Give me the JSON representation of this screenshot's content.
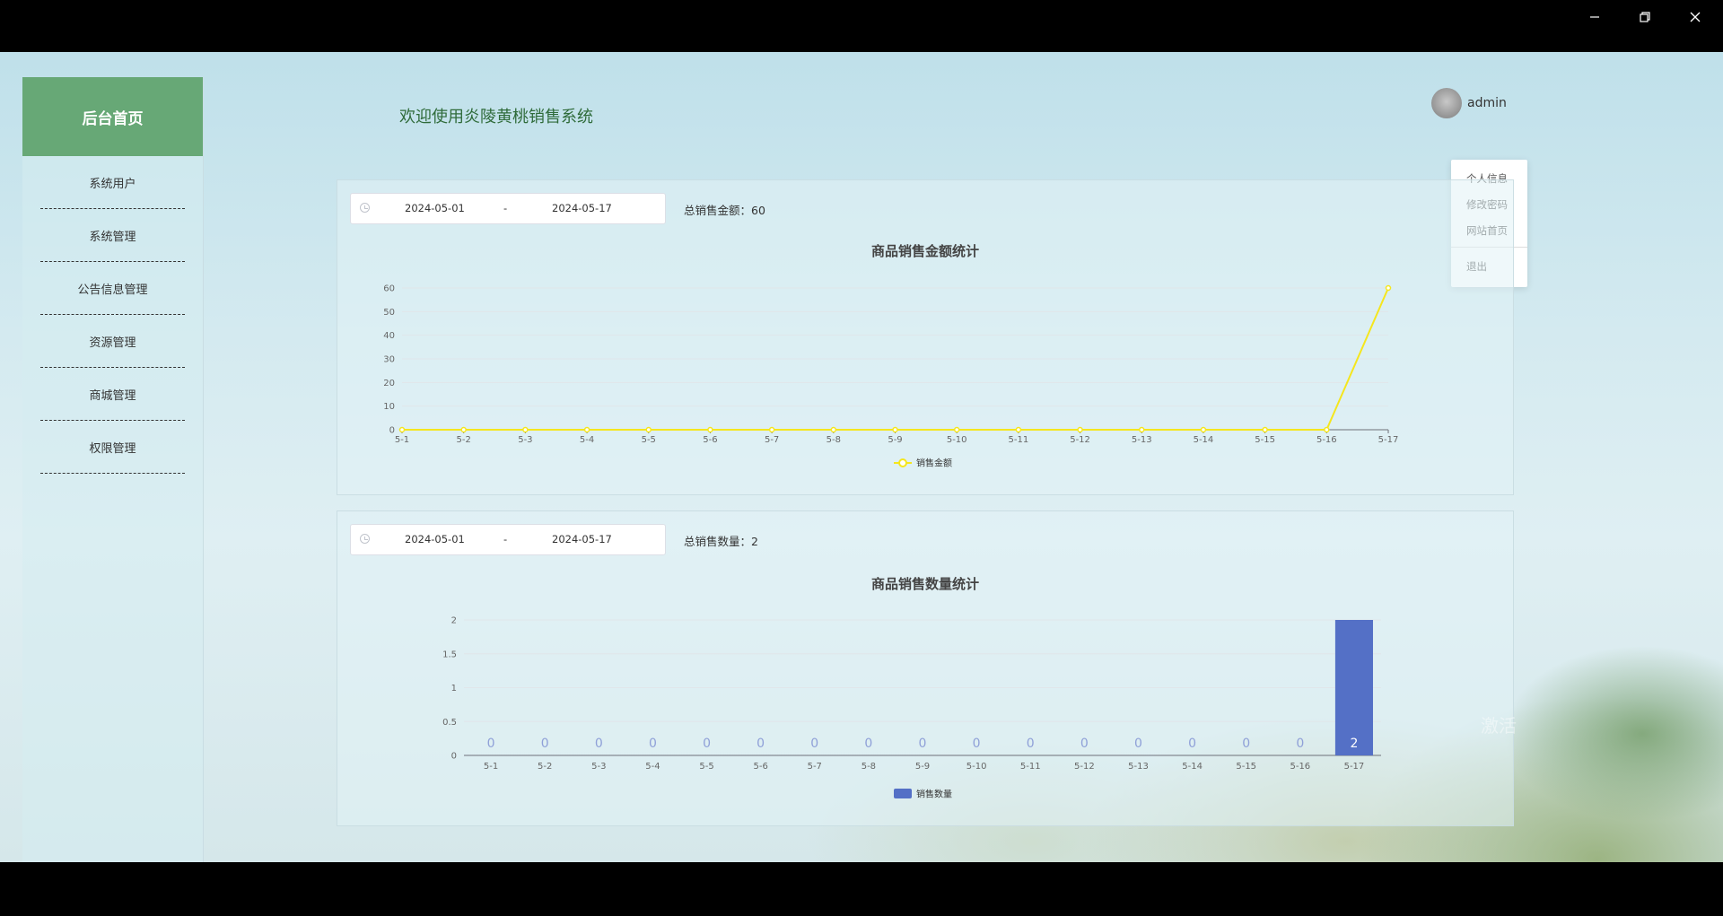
{
  "app": {
    "welcome": "欢迎使用炎陵黄桃销售系统"
  },
  "sidebar": {
    "logo": "后台首页",
    "items": [
      {
        "label": "系统用户"
      },
      {
        "label": "系统管理"
      },
      {
        "label": "公告信息管理"
      },
      {
        "label": "资源管理"
      },
      {
        "label": "商城管理"
      },
      {
        "label": "权限管理"
      }
    ]
  },
  "user": {
    "name": "admin",
    "menu": [
      {
        "label": "个人信息"
      },
      {
        "label": "修改密码"
      },
      {
        "label": "网站首页"
      },
      {
        "label": "退出"
      }
    ]
  },
  "panels": [
    {
      "start": "2024-05-01",
      "separator": "-",
      "end": "2024-05-17",
      "total_label": "总销售金额：60"
    },
    {
      "start": "2024-05-01",
      "separator": "-",
      "end": "2024-05-17",
      "total_label": "总销售数量：2"
    }
  ],
  "watermark": {
    "line1": "激活",
    "line2": ""
  },
  "colors": {
    "sidebar_logo": "#67a876",
    "line": "#f5e61d",
    "bar": "#5470c6"
  },
  "chart_data": [
    {
      "type": "line",
      "title": "商品销售金额统计",
      "categories": [
        "5-1",
        "5-2",
        "5-3",
        "5-4",
        "5-5",
        "5-6",
        "5-7",
        "5-8",
        "5-9",
        "5-10",
        "5-11",
        "5-12",
        "5-13",
        "5-14",
        "5-15",
        "5-16",
        "5-17"
      ],
      "series": [
        {
          "name": "销售金额",
          "values": [
            0,
            0,
            0,
            0,
            0,
            0,
            0,
            0,
            0,
            0,
            0,
            0,
            0,
            0,
            0,
            0,
            60
          ]
        }
      ],
      "yticks": [
        0,
        10,
        20,
        30,
        40,
        50,
        60
      ],
      "ylim": [
        0,
        60
      ],
      "legend": "bottom-center",
      "grid": true
    },
    {
      "type": "bar",
      "title": "商品销售数量统计",
      "categories": [
        "5-1",
        "5-2",
        "5-3",
        "5-4",
        "5-5",
        "5-6",
        "5-7",
        "5-8",
        "5-9",
        "5-10",
        "5-11",
        "5-12",
        "5-13",
        "5-14",
        "5-15",
        "5-16",
        "5-17"
      ],
      "series": [
        {
          "name": "销售数量",
          "values": [
            0,
            0,
            0,
            0,
            0,
            0,
            0,
            0,
            0,
            0,
            0,
            0,
            0,
            0,
            0,
            0,
            2
          ]
        }
      ],
      "yticks": [
        "0",
        "0.5",
        "1",
        "1.5",
        "2"
      ],
      "ylim": [
        0,
        2
      ],
      "legend": "bottom-center",
      "grid": true
    }
  ]
}
